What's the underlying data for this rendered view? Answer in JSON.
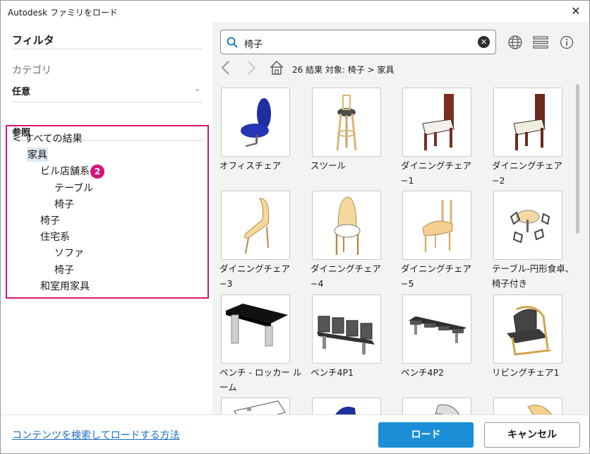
{
  "window": {
    "title": "Autodesk ファミリをロード"
  },
  "filter": {
    "heading": "フィルタ",
    "category_label": "カテゴリ",
    "category_value": "任意",
    "reference_heading": "参照"
  },
  "tree": [
    {
      "label": "< すべての結果",
      "level": 0,
      "selected": false
    },
    {
      "label": "家具",
      "level": 1,
      "selected": true
    },
    {
      "label": "ビル店舗系",
      "level": 2,
      "selected": false
    },
    {
      "label": "テーブル",
      "level": 3,
      "selected": false
    },
    {
      "label": "椅子",
      "level": 3,
      "selected": false
    },
    {
      "label": "椅子",
      "level": 2,
      "selected": false
    },
    {
      "label": "住宅系",
      "level": 2,
      "selected": false
    },
    {
      "label": "ソファ",
      "level": 3,
      "selected": false
    },
    {
      "label": "椅子",
      "level": 3,
      "selected": false
    },
    {
      "label": "和室用家具",
      "level": 2,
      "selected": false
    }
  ],
  "badge": "2",
  "search": {
    "value": "椅子",
    "icon": "search-icon",
    "clear_icon": "clear-icon"
  },
  "toolbar": {
    "globe_icon": "globe-icon",
    "list_icon": "list-view-icon",
    "info_icon": "info-icon"
  },
  "breadcrumb": "26 結果  対象: 椅子 > 家具",
  "results": [
    {
      "label": "オフィスチェア",
      "icon": "office-chair"
    },
    {
      "label": "スツール",
      "icon": "stool"
    },
    {
      "label": "ダイニングチェア−1",
      "icon": "dining-chair-1"
    },
    {
      "label": "ダイニングチェア−2",
      "icon": "dining-chair-2"
    },
    {
      "label": "ダイニングチェア−3",
      "icon": "dining-chair-3"
    },
    {
      "label": "ダイニングチェア−4",
      "icon": "dining-chair-4"
    },
    {
      "label": "ダイニングチェア−5",
      "icon": "dining-chair-5"
    },
    {
      "label": "テーブル-円形食卓、椅子付き",
      "icon": "round-table-set"
    },
    {
      "label": "ベンチ - ロッカー ルーム",
      "icon": "locker-bench"
    },
    {
      "label": "ベンチ4P1",
      "icon": "bench-4p1"
    },
    {
      "label": "ベンチ4P2",
      "icon": "bench-4p2"
    },
    {
      "label": "リビングチェア1",
      "icon": "living-chair-1"
    },
    {
      "label": "",
      "icon": "partial-1"
    },
    {
      "label": "",
      "icon": "partial-2"
    },
    {
      "label": "",
      "icon": "partial-3"
    },
    {
      "label": "",
      "icon": "partial-4"
    }
  ],
  "footer": {
    "help_link": "コンテンツを検索してロードする方法",
    "load_button": "ロード",
    "cancel_button": "キャンセル"
  },
  "colors": {
    "accent": "#1a8ed6",
    "highlight": "#d4157a",
    "link": "#1d6fc2"
  }
}
